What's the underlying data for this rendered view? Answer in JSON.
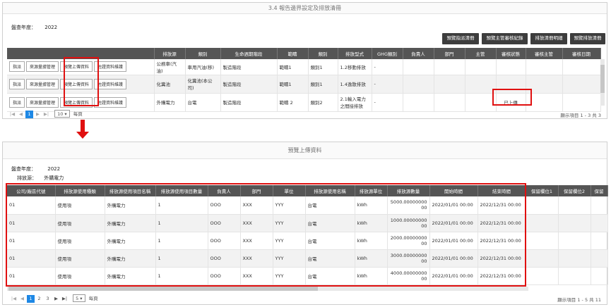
{
  "top": {
    "title": "3.4 報告邊界設定及排放清冊",
    "year_label": "盤查年度：",
    "year_value": "2022",
    "action_buttons": [
      "預覽指派清冊",
      "預覽主管審核紀錄",
      "排放清冊明細",
      "預覽排放清冊"
    ],
    "columns": [
      "",
      "排放源",
      "類別",
      "生命週期階段",
      "範疇",
      "類別",
      "排放型式",
      "GHG類別",
      "負責人",
      "部門",
      "主管",
      "審核狀態",
      "審核主管",
      "審核日期"
    ],
    "row_buttons": [
      "指派",
      "來源量據管理",
      "預覽上傳資料",
      "佐證資料維護"
    ],
    "rows": [
      {
        "source": "公務車(汽油)",
        "category": "車用汽油(移)",
        "stage": "製造階段",
        "scope": "範疇1",
        "cls": "類別1",
        "type": "1.2移動排放",
        "ghg": "-",
        "status": ""
      },
      {
        "source": "化糞池",
        "category": "化糞池(本公司)",
        "stage": "製造階段",
        "scope": "範疇1",
        "cls": "類別1",
        "type": "1.4逸散排放",
        "ghg": "-",
        "status": ""
      },
      {
        "source": "外購電力",
        "category": "台電",
        "stage": "製造階段",
        "scope": "範疇 2",
        "cls": "類別2",
        "type": "2.1輸入電力之間接排放",
        "ghg": "-",
        "status": "已上傳"
      }
    ],
    "pager": {
      "pages": [
        "1"
      ],
      "page_size": "10",
      "per_page_label": "每頁",
      "summary": "顯示項目 1 - 3 共 3"
    }
  },
  "bottom": {
    "title": "預覽上傳資料",
    "year_label": "盤查年度：",
    "year_value": "2022",
    "source_label": "排放源：",
    "source_value": "外購電力",
    "columns": [
      "公司/廠區代號",
      "排放源使用種類",
      "排放源使用項目名稱",
      "排放源使用項目數量",
      "負責人",
      "部門",
      "單位",
      "排放源使用名稱",
      "排放源單位",
      "排放源數量",
      "開始時間",
      "結束時間",
      "保留欄位1",
      "保留欄位2",
      "保留"
    ],
    "rows": [
      [
        "01",
        "使用項",
        "外購電力",
        "1",
        "OOO",
        "XXX",
        "YYY",
        "台電",
        "kWh",
        "5000.0000000000",
        "2022/01/01 00:00",
        "2022/12/31 00:00",
        "",
        "",
        ""
      ],
      [
        "01",
        "使用項",
        "外購電力",
        "1",
        "OOO",
        "XXX",
        "YYY",
        "台電",
        "kWh",
        "1000.0000000000",
        "2022/01/01 00:00",
        "2022/12/31 00:00",
        "",
        "",
        ""
      ],
      [
        "01",
        "使用項",
        "外購電力",
        "1",
        "OOO",
        "XXX",
        "YYY",
        "台電",
        "kWh",
        "2000.0000000000",
        "2022/01/01 00:00",
        "2022/12/31 00:00",
        "",
        "",
        ""
      ],
      [
        "01",
        "使用項",
        "外購電力",
        "1",
        "OOO",
        "XXX",
        "YYY",
        "台電",
        "kWh",
        "3000.0000000000",
        "2022/01/01 00:00",
        "2022/12/31 00:00",
        "",
        "",
        ""
      ],
      [
        "01",
        "使用項",
        "外購電力",
        "1",
        "OOO",
        "XXX",
        "YYY",
        "台電",
        "kWh",
        "4000.0000000000",
        "2022/01/01 00:00",
        "2022/12/31 00:00",
        "",
        "",
        ""
      ]
    ],
    "pager": {
      "pages": [
        "1",
        "2",
        "3"
      ],
      "page_size": "5",
      "per_page_label": "每頁",
      "summary": "顯示項目 1 - 5 共 11"
    }
  },
  "colors": {
    "highlight": "#e01010",
    "header": "#555555",
    "active_page": "#1e88e5"
  }
}
